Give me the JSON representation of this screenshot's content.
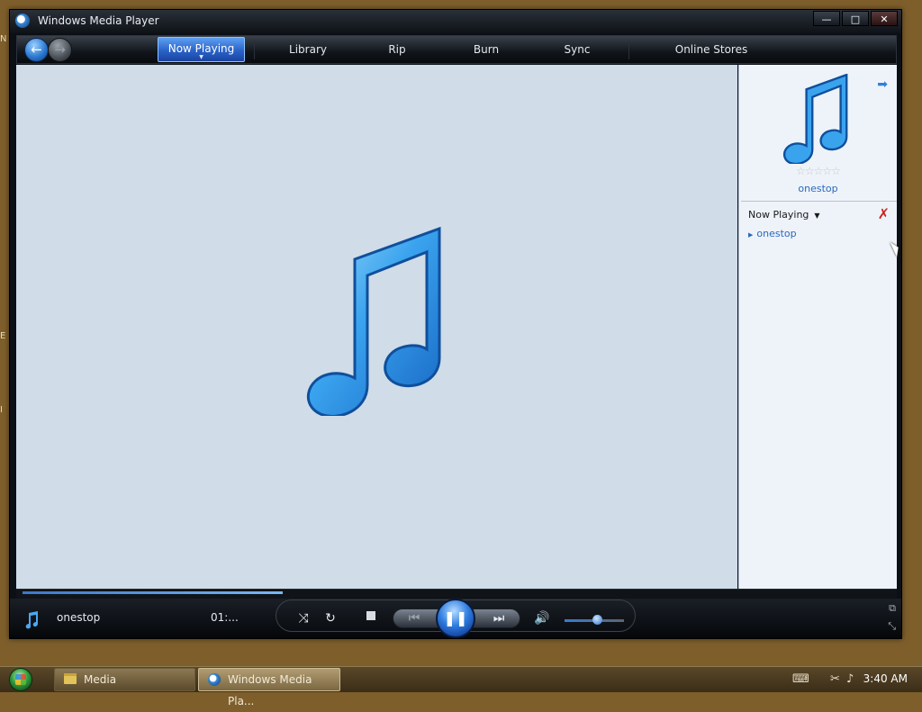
{
  "window": {
    "title": "Windows Media Player",
    "controls": {
      "minimize": "—",
      "maximize": "□",
      "close": "✕"
    }
  },
  "nav": {
    "back_icon": "arrow-left-icon",
    "forward_icon": "arrow-right-icon",
    "tabs": [
      {
        "label": "Now Playing",
        "active": true
      },
      {
        "label": "Library",
        "active": false
      },
      {
        "label": "Rip",
        "active": false
      },
      {
        "label": "Burn",
        "active": false
      },
      {
        "label": "Sync",
        "active": false
      },
      {
        "label": "Online Stores",
        "active": false
      }
    ]
  },
  "list_pane": {
    "album_title": "onestop",
    "rating_stars": "☆☆☆☆☆",
    "header": "Now Playing",
    "items": [
      "onestop"
    ]
  },
  "status": {
    "track": "onestop",
    "time": "01:..."
  },
  "seek_progress_percent": 30,
  "volume_percent": 55,
  "taskbar": {
    "buttons": [
      {
        "label": "Media",
        "icon": "folder-icon"
      },
      {
        "label": "Windows Media Pla...",
        "icon": "wmp-icon",
        "active": true
      }
    ],
    "clock": "3:40 AM"
  },
  "colors": {
    "accent": "#2f7de0",
    "vis_background": "#d0dce8",
    "list_background": "#eef3f9",
    "desktop": "#7e5f2c"
  }
}
